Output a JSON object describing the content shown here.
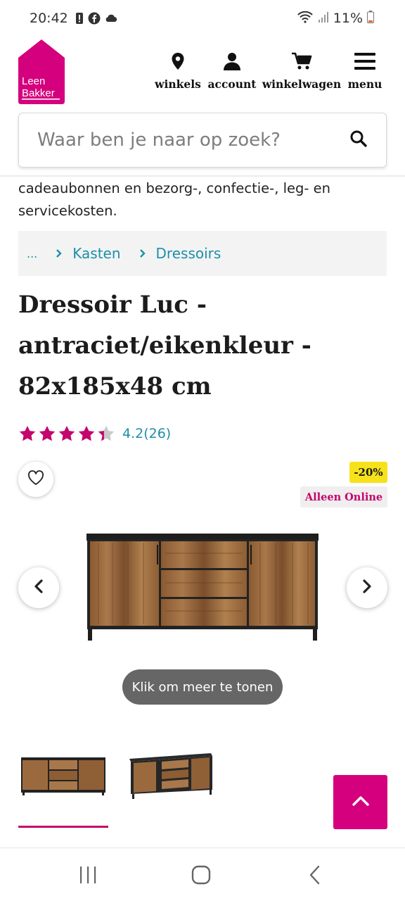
{
  "status_bar": {
    "time": "20:42",
    "battery": "11%"
  },
  "header": {
    "logo_text_line1": "Leen",
    "logo_text_line2": "Bakker",
    "nav": [
      {
        "label": "winkels",
        "icon": "location-pin-icon"
      },
      {
        "label": "account",
        "icon": "user-icon"
      },
      {
        "label": "winkelwagen",
        "icon": "cart-icon"
      },
      {
        "label": "menu",
        "icon": "hamburger-menu-icon"
      }
    ]
  },
  "search": {
    "placeholder": "Waar ben je naar op zoek?"
  },
  "intro_text": "cadeaubonnen en bezorg-, confectie-, leg- en servicekosten.",
  "breadcrumb": {
    "ellipsis": "...",
    "items": [
      "Kasten",
      "Dressoirs"
    ]
  },
  "product": {
    "title": "Dressoir Luc - antraciet/eikenkleur - 82x185x48 cm",
    "rating": 4.2,
    "rating_text": "4.2(26)",
    "badge_discount": "-20%",
    "badge_online": "Alleen Online",
    "show_more_label": "Klik om meer te tonen"
  },
  "colors": {
    "brand": "#d5007d",
    "link": "#1d8fa8",
    "badge_yellow": "#f6e21a"
  }
}
